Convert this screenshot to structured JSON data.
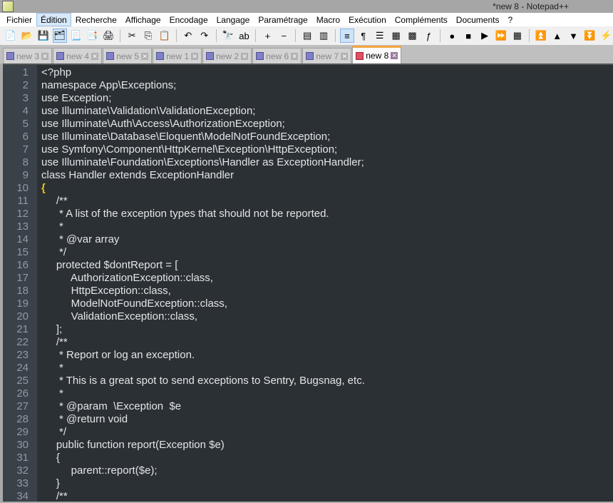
{
  "window": {
    "title": "*new 8 - Notepad++"
  },
  "menu": [
    "Fichier",
    "Édition",
    "Recherche",
    "Affichage",
    "Encodage",
    "Langage",
    "Paramétrage",
    "Macro",
    "Exécution",
    "Compléments",
    "Documents",
    "?"
  ],
  "toolbar": [
    {
      "icon": "new-file-icon",
      "g": "📄"
    },
    {
      "icon": "open-file-icon",
      "g": "📂"
    },
    {
      "icon": "save-icon",
      "g": "💾"
    },
    {
      "icon": "save-all-icon",
      "g": "🗂",
      "on": true
    },
    {
      "icon": "close-icon",
      "g": "📃"
    },
    {
      "icon": "close-all-icon",
      "g": "📑"
    },
    {
      "icon": "print-icon",
      "g": "🖨"
    },
    "sep",
    {
      "icon": "cut-icon",
      "g": "✂"
    },
    {
      "icon": "copy-icon",
      "g": "⎘"
    },
    {
      "icon": "paste-icon",
      "g": "📋"
    },
    "sep",
    {
      "icon": "undo-icon",
      "g": "↶"
    },
    {
      "icon": "redo-icon",
      "g": "↷"
    },
    "sep",
    {
      "icon": "find-icon",
      "g": "🔭"
    },
    {
      "icon": "replace-icon",
      "g": "ab"
    },
    "sep",
    {
      "icon": "zoom-in-icon",
      "g": "+"
    },
    {
      "icon": "zoom-out-icon",
      "g": "−"
    },
    "sep",
    {
      "icon": "sync-v-icon",
      "g": "▤"
    },
    {
      "icon": "sync-h-icon",
      "g": "▥"
    },
    "sep",
    {
      "icon": "word-wrap-icon",
      "g": "≡",
      "on": true
    },
    {
      "icon": "show-all-chars-icon",
      "g": "¶"
    },
    {
      "icon": "indent-guide-icon",
      "g": "☰"
    },
    {
      "icon": "udl-icon",
      "g": "▦"
    },
    {
      "icon": "doc-map-icon",
      "g": "▩"
    },
    {
      "icon": "function-list-icon",
      "g": "ƒ"
    },
    "sep",
    {
      "icon": "record-macro-icon",
      "g": "●"
    },
    {
      "icon": "stop-macro-icon",
      "g": "■"
    },
    {
      "icon": "play-macro-icon",
      "g": "▶"
    },
    {
      "icon": "play-multiple-icon",
      "g": "⏩"
    },
    {
      "icon": "save-macro-icon",
      "g": "▦"
    },
    "sep",
    {
      "icon": "first-icon",
      "g": "⏫"
    },
    {
      "icon": "up-icon",
      "g": "▲"
    },
    {
      "icon": "down-icon",
      "g": "▼"
    },
    {
      "icon": "last-icon",
      "g": "⏬"
    },
    {
      "icon": "run-icon",
      "g": "⚡"
    }
  ],
  "tabs": [
    {
      "label": "new 3"
    },
    {
      "label": "new 4"
    },
    {
      "label": "new 5"
    },
    {
      "label": "new 1"
    },
    {
      "label": "new 2"
    },
    {
      "label": "new 6"
    },
    {
      "label": "new 7"
    },
    {
      "label": "new 8",
      "active": true
    }
  ],
  "code": [
    "<?php",
    "namespace App\\Exceptions;",
    "use Exception;",
    "use Illuminate\\Validation\\ValidationException;",
    "use Illuminate\\Auth\\Access\\AuthorizationException;",
    "use Illuminate\\Database\\Eloquent\\ModelNotFoundException;",
    "use Symfony\\Component\\HttpKernel\\Exception\\HttpException;",
    "use Illuminate\\Foundation\\Exceptions\\Handler as ExceptionHandler;",
    "class Handler extends ExceptionHandler",
    "{",
    "     /**",
    "      * A list of the exception types that should not be reported.",
    "      *",
    "      * @var array",
    "      */",
    "     protected $dontReport = [",
    "          AuthorizationException::class,",
    "          HttpException::class,",
    "          ModelNotFoundException::class,",
    "          ValidationException::class,",
    "     ];",
    "     /**",
    "      * Report or log an exception.",
    "      *",
    "      * This is a great spot to send exceptions to Sentry, Bugsnag, etc.",
    "      *",
    "      * @param  \\Exception  $e",
    "      * @return void",
    "      */",
    "     public function report(Exception $e)",
    "     {",
    "          parent::report($e);",
    "     }",
    "     /**"
  ],
  "highlight_line": 10
}
